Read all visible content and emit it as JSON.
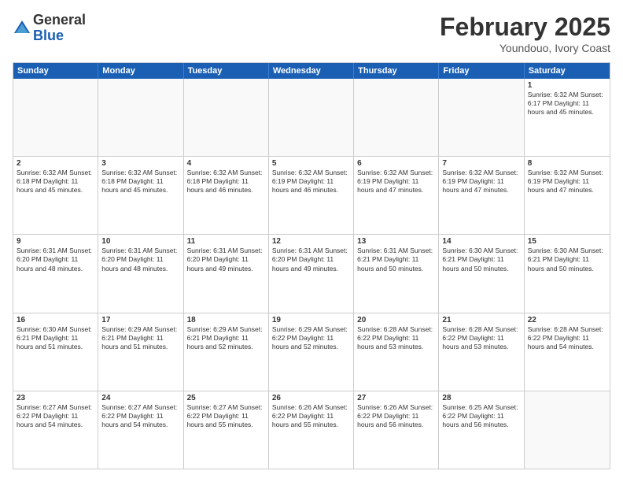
{
  "logo": {
    "general": "General",
    "blue": "Blue"
  },
  "header": {
    "month": "February 2025",
    "location": "Youndouo, Ivory Coast"
  },
  "dayHeaders": [
    "Sunday",
    "Monday",
    "Tuesday",
    "Wednesday",
    "Thursday",
    "Friday",
    "Saturday"
  ],
  "weeks": [
    {
      "days": [
        {
          "number": "",
          "info": ""
        },
        {
          "number": "",
          "info": ""
        },
        {
          "number": "",
          "info": ""
        },
        {
          "number": "",
          "info": ""
        },
        {
          "number": "",
          "info": ""
        },
        {
          "number": "",
          "info": ""
        },
        {
          "number": "1",
          "info": "Sunrise: 6:32 AM\nSunset: 6:17 PM\nDaylight: 11 hours\nand 45 minutes."
        }
      ]
    },
    {
      "days": [
        {
          "number": "2",
          "info": "Sunrise: 6:32 AM\nSunset: 6:18 PM\nDaylight: 11 hours\nand 45 minutes."
        },
        {
          "number": "3",
          "info": "Sunrise: 6:32 AM\nSunset: 6:18 PM\nDaylight: 11 hours\nand 45 minutes."
        },
        {
          "number": "4",
          "info": "Sunrise: 6:32 AM\nSunset: 6:18 PM\nDaylight: 11 hours\nand 46 minutes."
        },
        {
          "number": "5",
          "info": "Sunrise: 6:32 AM\nSunset: 6:19 PM\nDaylight: 11 hours\nand 46 minutes."
        },
        {
          "number": "6",
          "info": "Sunrise: 6:32 AM\nSunset: 6:19 PM\nDaylight: 11 hours\nand 47 minutes."
        },
        {
          "number": "7",
          "info": "Sunrise: 6:32 AM\nSunset: 6:19 PM\nDaylight: 11 hours\nand 47 minutes."
        },
        {
          "number": "8",
          "info": "Sunrise: 6:32 AM\nSunset: 6:19 PM\nDaylight: 11 hours\nand 47 minutes."
        }
      ]
    },
    {
      "days": [
        {
          "number": "9",
          "info": "Sunrise: 6:31 AM\nSunset: 6:20 PM\nDaylight: 11 hours\nand 48 minutes."
        },
        {
          "number": "10",
          "info": "Sunrise: 6:31 AM\nSunset: 6:20 PM\nDaylight: 11 hours\nand 48 minutes."
        },
        {
          "number": "11",
          "info": "Sunrise: 6:31 AM\nSunset: 6:20 PM\nDaylight: 11 hours\nand 49 minutes."
        },
        {
          "number": "12",
          "info": "Sunrise: 6:31 AM\nSunset: 6:20 PM\nDaylight: 11 hours\nand 49 minutes."
        },
        {
          "number": "13",
          "info": "Sunrise: 6:31 AM\nSunset: 6:21 PM\nDaylight: 11 hours\nand 50 minutes."
        },
        {
          "number": "14",
          "info": "Sunrise: 6:30 AM\nSunset: 6:21 PM\nDaylight: 11 hours\nand 50 minutes."
        },
        {
          "number": "15",
          "info": "Sunrise: 6:30 AM\nSunset: 6:21 PM\nDaylight: 11 hours\nand 50 minutes."
        }
      ]
    },
    {
      "days": [
        {
          "number": "16",
          "info": "Sunrise: 6:30 AM\nSunset: 6:21 PM\nDaylight: 11 hours\nand 51 minutes."
        },
        {
          "number": "17",
          "info": "Sunrise: 6:29 AM\nSunset: 6:21 PM\nDaylight: 11 hours\nand 51 minutes."
        },
        {
          "number": "18",
          "info": "Sunrise: 6:29 AM\nSunset: 6:21 PM\nDaylight: 11 hours\nand 52 minutes."
        },
        {
          "number": "19",
          "info": "Sunrise: 6:29 AM\nSunset: 6:22 PM\nDaylight: 11 hours\nand 52 minutes."
        },
        {
          "number": "20",
          "info": "Sunrise: 6:28 AM\nSunset: 6:22 PM\nDaylight: 11 hours\nand 53 minutes."
        },
        {
          "number": "21",
          "info": "Sunrise: 6:28 AM\nSunset: 6:22 PM\nDaylight: 11 hours\nand 53 minutes."
        },
        {
          "number": "22",
          "info": "Sunrise: 6:28 AM\nSunset: 6:22 PM\nDaylight: 11 hours\nand 54 minutes."
        }
      ]
    },
    {
      "days": [
        {
          "number": "23",
          "info": "Sunrise: 6:27 AM\nSunset: 6:22 PM\nDaylight: 11 hours\nand 54 minutes."
        },
        {
          "number": "24",
          "info": "Sunrise: 6:27 AM\nSunset: 6:22 PM\nDaylight: 11 hours\nand 54 minutes."
        },
        {
          "number": "25",
          "info": "Sunrise: 6:27 AM\nSunset: 6:22 PM\nDaylight: 11 hours\nand 55 minutes."
        },
        {
          "number": "26",
          "info": "Sunrise: 6:26 AM\nSunset: 6:22 PM\nDaylight: 11 hours\nand 55 minutes."
        },
        {
          "number": "27",
          "info": "Sunrise: 6:26 AM\nSunset: 6:22 PM\nDaylight: 11 hours\nand 56 minutes."
        },
        {
          "number": "28",
          "info": "Sunrise: 6:25 AM\nSunset: 6:22 PM\nDaylight: 11 hours\nand 56 minutes."
        },
        {
          "number": "",
          "info": ""
        }
      ]
    }
  ]
}
